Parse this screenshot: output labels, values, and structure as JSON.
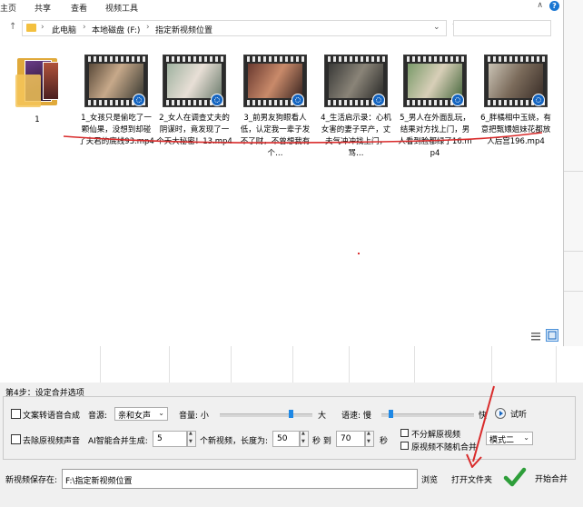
{
  "explorer": {
    "ribbon_tabs": [
      "主页",
      "共享",
      "查看",
      "视频工具"
    ],
    "address": {
      "segments": [
        "此电脑",
        "本地磁盘 (F:)",
        "指定新视频位置"
      ]
    },
    "folder": {
      "label": "1"
    },
    "files": [
      "1_女孩只是偷吃了一颗仙果，没想到却碰了夫君的底线93.mp4",
      "2_女人在调查丈夫的阴谋时，竟发现了一个天大秘密！13.mp4",
      "3_前男友狗眼看人低，认定我一辈子发不了财，不曾想我有个…",
      "4_生活启示录：心机女害的妻子早产，丈夫气冲冲找上门，骂…",
      "5_男人在外面乱玩，结果对方找上门，男人看到脸都绿了16.mp4",
      "6_胖橘相中玉娆，有意把甄嬛姐妹花都放人后宫196.mp4"
    ]
  },
  "step4": {
    "title": "第4步：设定合并选项",
    "tts_checkbox": "文案转语音合成",
    "voice_label": "音源:",
    "voice_value": "亲和女声",
    "volume_label": "音量: 小",
    "volume_max": "大",
    "speed_label": "语速: 慢",
    "speed_max": "快",
    "trial_label": "试听",
    "remove_audio_checkbox": "去除原视频声音",
    "ai_label": "AI智能合并生成:",
    "count_value": "5",
    "count_unit": "个新视频，长度为:",
    "len_min": "50",
    "sec_to": "秒 到",
    "len_max": "70",
    "sec": "秒",
    "no_split_checkbox": "不分解原视频",
    "no_random_checkbox": "原视频不随机合并",
    "mode_value": "模式二"
  },
  "save": {
    "label": "新视频保存在:",
    "path": "F:\\指定新视频位置",
    "browse": "浏览",
    "open_folder": "打开文件夹",
    "start": "开始合并"
  }
}
